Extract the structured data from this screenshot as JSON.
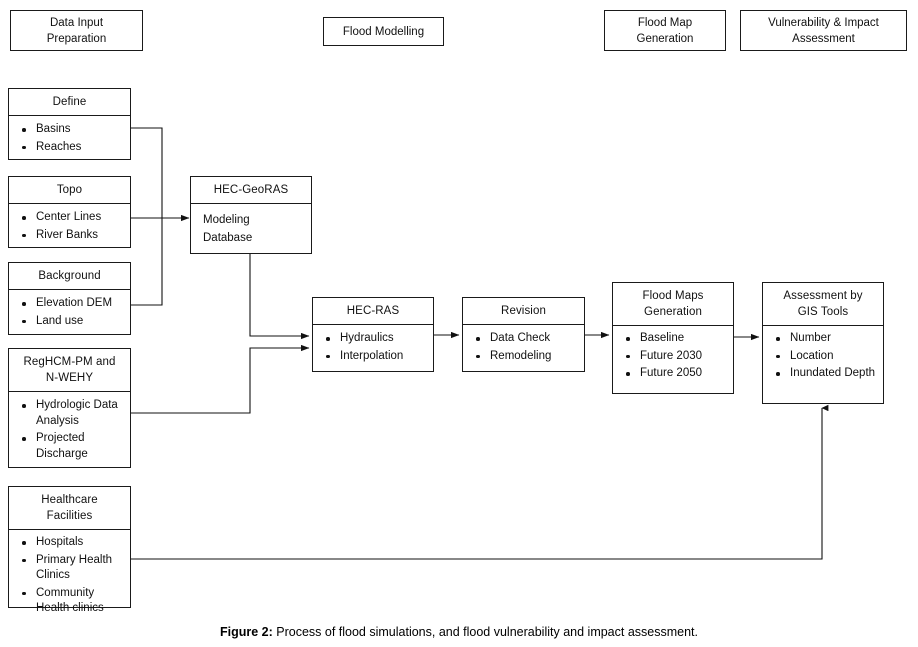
{
  "figure": {
    "label": "Figure 2:",
    "caption": " Process of flood simulations, and flood vulnerability and impact assessment."
  },
  "phases": [
    {
      "name": "data-input-preparation",
      "lines": [
        "Data Input",
        "Preparation"
      ]
    },
    {
      "name": "flood-modelling",
      "lines": [
        "Flood Modelling"
      ]
    },
    {
      "name": "flood-map-generation",
      "lines": [
        "Flood Map",
        "Generation"
      ]
    },
    {
      "name": "vulnerability-impact-assessment",
      "lines": [
        "Vulnerability & Impact",
        "Assessment"
      ]
    }
  ],
  "nodes": {
    "define": {
      "title": "Define",
      "items": [
        "Basins",
        "Reaches"
      ]
    },
    "topo": {
      "title": "Topo",
      "items": [
        "Center Lines",
        "River Banks"
      ]
    },
    "background": {
      "title": "Background",
      "items": [
        "Elevation DEM",
        "Land use"
      ]
    },
    "reghcm": {
      "title_line1": "RegHCM-PM and",
      "title_line2": "N-WEHY",
      "items": [
        "Hydrologic Data Analysis",
        "Projected Discharge"
      ]
    },
    "healthcare": {
      "title_line1": "Healthcare",
      "title_line2": "Facilities",
      "items": [
        "Hospitals",
        "Primary Health Clinics",
        "Community Health clinics"
      ]
    },
    "hecgeoras": {
      "title": "HEC-GeoRAS",
      "line1": "Modeling",
      "line2": "Database"
    },
    "hecras": {
      "title": "HEC-RAS",
      "items": [
        "Hydraulics",
        "Interpolation"
      ]
    },
    "revision": {
      "title": "Revision",
      "items": [
        "Data Check",
        "Remodeling"
      ]
    },
    "floodmaps": {
      "title_line1": "Flood Maps",
      "title_line2": "Generation",
      "items": [
        "Baseline",
        "Future 2030",
        "Future 2050"
      ]
    },
    "assessment": {
      "title_line1": "Assessment by",
      "title_line2": "GIS Tools",
      "items": [
        "Number",
        "Location",
        "Inundated Depth"
      ]
    }
  },
  "colors": {
    "stroke": "#1a1a1a",
    "text": "#111111",
    "background": "#ffffff"
  }
}
